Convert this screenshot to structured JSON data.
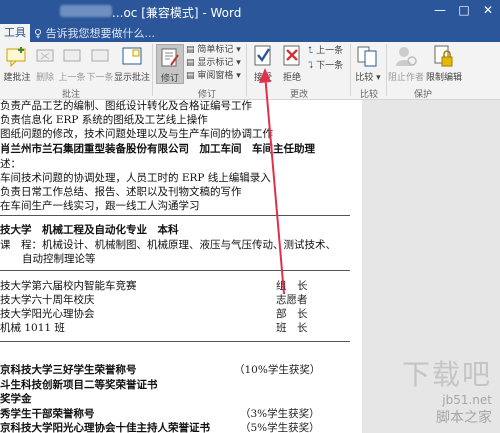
{
  "window": {
    "title": "...oc [兼容模式] - Word",
    "minimize": "—",
    "maximize": "□",
    "close": "✕"
  },
  "tabs": {
    "active": "工具",
    "tell_me": "告诉我您想要做什么..."
  },
  "ribbon": {
    "comments_group": {
      "label": "批注",
      "new_comment": "建批注",
      "delete": "删除",
      "previous": "上一条",
      "next": "下一条",
      "show_comments": "显示批注"
    },
    "tracking_group": {
      "label": "修订",
      "track_changes": "修订",
      "simple_markup": "简单标记",
      "show_markup": "显示标记",
      "reviewing_pane": "审阅窗格"
    },
    "changes_group": {
      "label": "更改",
      "accept": "接受",
      "reject": "拒绝",
      "previous": "上一条",
      "next": "下一条"
    },
    "compare_group": {
      "label": "比较",
      "compare": "比较"
    },
    "protect_group": {
      "label": "保护",
      "block_authors": "阻止作者",
      "restrict_editing": "限制编辑"
    }
  },
  "document": {
    "lines": [
      "负责产品工艺的编制、图纸设计转化及合格证编号工作",
      "负责信息化 ERP 系统的图纸及工艺线上操作",
      "图纸问题的修改，技术问题处理以及与生产车间的协调工作",
      "肖兰州市兰石集团重型装备股份有限公司　加工车间　车间主任助理",
      "述：",
      "车间技术问题的协调处理，人员工时的 ERP 线上编辑录入",
      "负责日常工作总结、报告、述职以及刊物文稿的写作",
      "在车间生产一线实习，跟一线工人沟通学习",
      "技大学　机械工程及自动化专业　本科",
      "课　程：机械设计、机械制图、机械原理、液压与气压传动、测试技术、",
      "自动控制理论等",
      "技大学第六届校内智能车竞赛",
      "技大学六十周年校庆",
      "技大学阳光心理协会",
      "机械 1011 班",
      "京科技大学三好学生荣誉称号",
      "斗生科技创新项目二等奖荣誉证书",
      "奖学金",
      "秀学生干部荣誉称号",
      "京科技大学阳光心理协会十佳主持人荣誉证书"
    ],
    "roles": [
      "组　长",
      "志愿者",
      "部　长",
      "班　长"
    ],
    "awards": [
      "（10%学生获奖）",
      "（3%学生获奖）",
      "（5%学生获奖）"
    ]
  },
  "watermark": {
    "big": "下载吧",
    "site": "jb51.net",
    "cn": "脚本之家"
  },
  "colors": {
    "titlebar": "#2b579a",
    "accept_check": "#2b579a",
    "reject_x": "#d13438",
    "arrow": "#e0304a"
  }
}
